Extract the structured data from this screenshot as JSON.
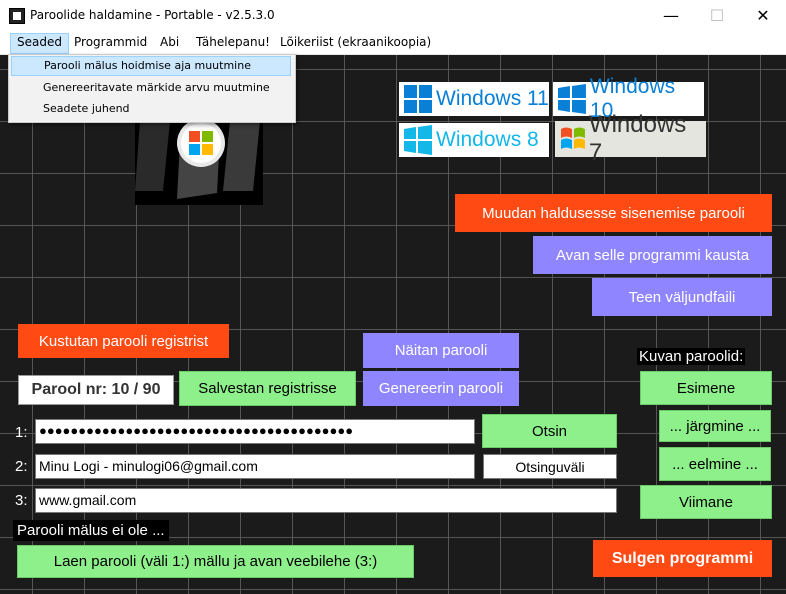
{
  "window": {
    "title": "Paroolide haldamine - Portable - v2.5.3.0",
    "minimize_glyph": "—",
    "maximize_glyph": "☐",
    "close_glyph": "✕"
  },
  "menubar": {
    "items": [
      "Seaded",
      "Programmid",
      "Abi",
      "Tähelepanu!",
      "Lõikeriist (ekraanikoopia)"
    ]
  },
  "dropdown": {
    "items": [
      "Parooli mälus hoidmise aja muutmine",
      "Genereeritavate märkide arvu muutmine",
      "Seadete juhend"
    ]
  },
  "logos": {
    "win11": "Windows 11",
    "win10": "Windows 10",
    "win8": "Windows 8",
    "win7": "Windows 7"
  },
  "buttons": {
    "change_password": "Muudan haldusesse sisenemise parooli",
    "open_folder": "Avan selle programmi kausta",
    "make_output": "Teen väljundfaili",
    "delete_registry": "Kustutan parooli registrist",
    "show_password": "Näitan parooli",
    "save_registry": "Salvestan registrisse",
    "generate_password": "Genereerin parooli",
    "search": "Otsin",
    "search_field_label": "Otsinguväli",
    "first": "Esimene",
    "next": "... järgmine ...",
    "prev": "... eelmine ...",
    "last": "Viimane",
    "load_password": "Laen parooli (väli 1:) mällu ja avan veebilehe (3:)",
    "close_program": "Sulgen programmi"
  },
  "labels": {
    "password_nr": "Parool nr:  10 / 90",
    "show_passwords": "Kuvan paroolid:",
    "field1": "1:",
    "field2": "2:",
    "field3": "3:",
    "memory_status": "Parooli mälus ei ole ..."
  },
  "fields": {
    "password": "●●●●●●●●●●●●●●●●●●●●●●●●●●●●●●●●●●●●●●●●",
    "username": "Minu Logi - minulogi06@gmail.com",
    "url": "www.gmail.com"
  },
  "colors": {
    "green": "#8ef08a",
    "red": "#ff4a14",
    "purple": "#8f86ff",
    "background": "#1b1b1b"
  }
}
